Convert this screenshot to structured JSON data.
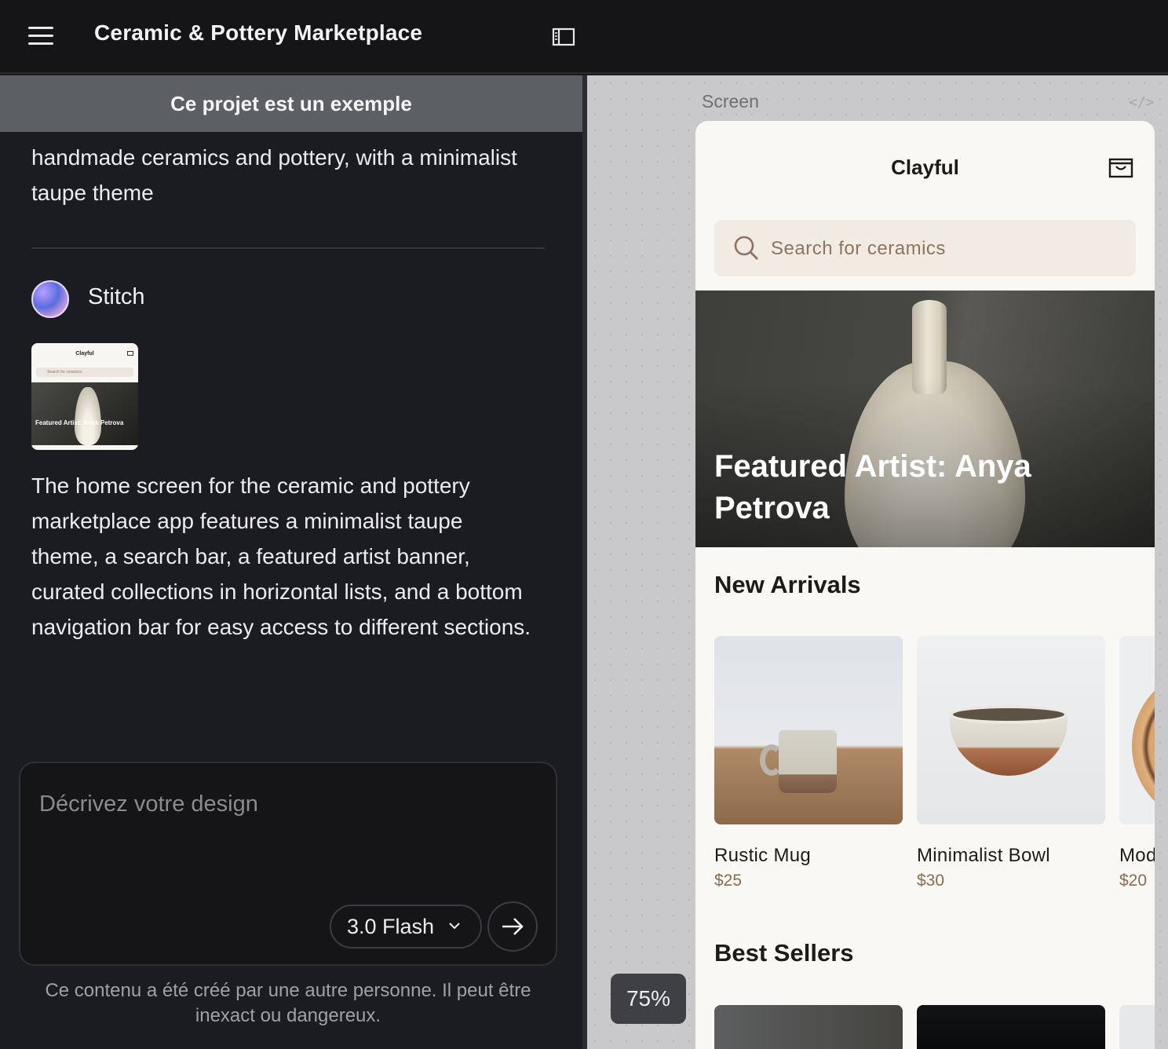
{
  "app": {
    "title": "Ceramic & Pottery Marketplace"
  },
  "left_panel": {
    "banner": "Ce projet est un exemple",
    "prompt_text": "handmade ceramics and pottery, with a minimalist taupe theme",
    "agent": {
      "name": "Stitch"
    },
    "thumbnail": {
      "brand": "Clayful",
      "search": "Search for ceramics",
      "caption": "Featured Artist: Anya Petrova"
    },
    "description": "The home screen for the ceramic and pottery marketplace app features a minimalist taupe theme, a search bar, a featured artist banner, curated collections in horizontal lists, and a bottom navigation bar for easy access to different sections.",
    "composer": {
      "placeholder": "Décrivez votre design",
      "model": "3.0 Flash"
    },
    "disclaimer": "Ce contenu a été créé par une autre personne. Il peut être inexact ou dangereux."
  },
  "canvas": {
    "screen_label": "Screen",
    "code_icon": "</>",
    "zoom": "75%"
  },
  "phone": {
    "brand": "Clayful",
    "search_placeholder": "Search for ceramics",
    "hero_caption": "Featured Artist: Anya Petrova",
    "new_arrivals_title": "New Arrivals",
    "products": [
      {
        "name": "Rustic Mug",
        "price": "$25"
      },
      {
        "name": "Minimalist Bowl",
        "price": "$30"
      },
      {
        "name": "Mod",
        "price": "$20"
      }
    ],
    "best_sellers_title": "Best Sellers"
  },
  "icons": {
    "menu": "hamburger-menu-icon",
    "panel": "sidebar-panel-icon",
    "cart": "shopping-bag-icon",
    "search": "search-icon",
    "send": "arrow-right-icon",
    "chevron": "chevron-down-icon"
  },
  "colors": {
    "topbar": "#151518",
    "panel": "#1b1c21",
    "banner": "#5c5f64",
    "canvas": "#c9c9cb",
    "phone_bg": "#faf8f5",
    "search_bg": "#f1ebe4",
    "price": "#8a6b4e"
  }
}
